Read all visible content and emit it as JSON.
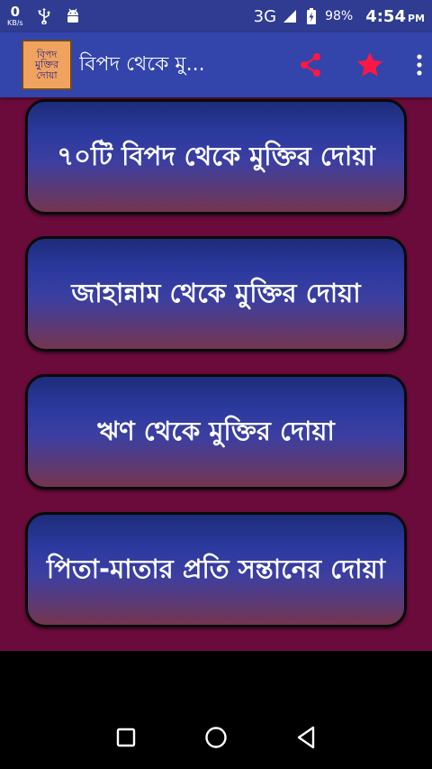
{
  "status_bar": {
    "speed_value": "0",
    "speed_unit": "KB/s",
    "network": "3G",
    "battery": "98%",
    "time": "4:54",
    "ampm": "PM"
  },
  "app_bar": {
    "logo_lines": [
      "বিপদ",
      "মুক্তির",
      "দোয়া"
    ],
    "title": "বিপদ থেকে মু...",
    "accent_colors": {
      "share": "#ff1744",
      "star": "#ff1744"
    }
  },
  "menu": {
    "items": [
      {
        "label": "৭০টি বিপদ থেকে মুক্তির দোয়া"
      },
      {
        "label": "জাহান্নাম থেকে মুক্তির দোয়া"
      },
      {
        "label": "ঋণ থেকে মুক্তির দোয়া"
      },
      {
        "label": "পিতা-মাতার প্রতি সন্তানের দোয়া"
      }
    ]
  },
  "icons": {
    "status": [
      "usb-icon",
      "android-icon",
      "signal-icon",
      "battery-icon"
    ],
    "app_bar": [
      "share-icon",
      "star-icon",
      "more-vert-icon"
    ],
    "nav": [
      "recents-icon",
      "home-icon",
      "back-icon"
    ]
  }
}
